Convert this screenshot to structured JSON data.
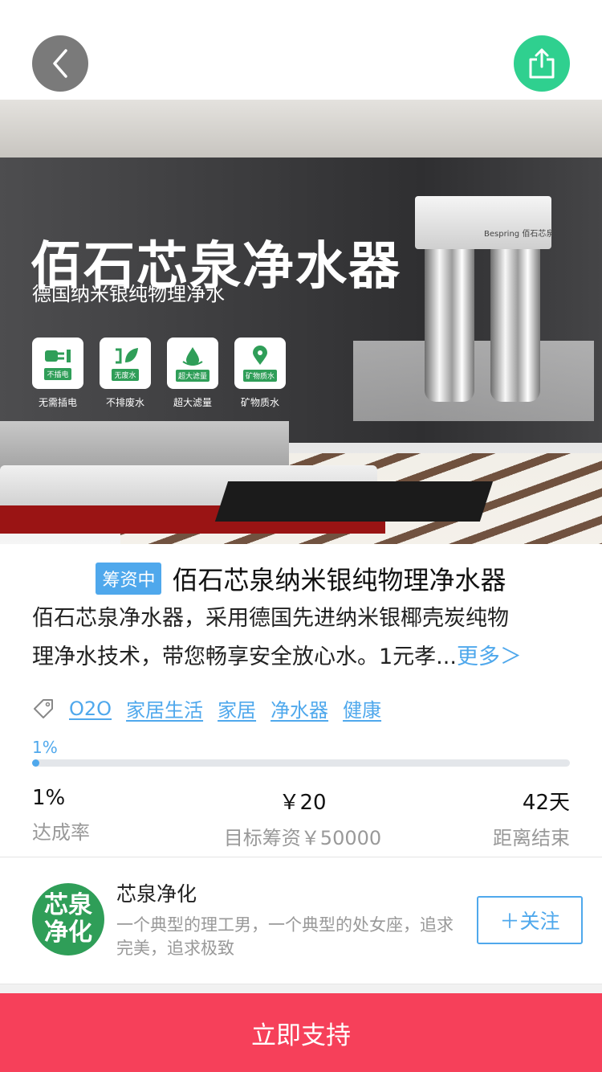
{
  "header": {
    "back_icon": "chevron-left-icon",
    "share_icon": "share-upload-icon",
    "share_color": "#2fd08f"
  },
  "hero": {
    "title": "佰石芯泉净水器",
    "subtitle": "德国纳米银纯物理净水",
    "features": [
      {
        "tag": "不插电",
        "caption": "无需插电",
        "icon": "plug-icon"
      },
      {
        "tag": "无废水",
        "caption": "不排废水",
        "icon": "leaf-icon"
      },
      {
        "tag": "超大滤量",
        "caption": "超大滤量",
        "icon": "water-drop-icon"
      },
      {
        "tag": "矿物质水",
        "caption": "矿物质水",
        "icon": "location-drop-icon"
      }
    ],
    "product_brand": "Bespring 佰石芯泉"
  },
  "project": {
    "status_badge": "筹资中",
    "title": "佰石芯泉纳米银纯物理净水器",
    "description_line1": "佰石芯泉净水器，采用德国先进纳米银椰壳炭纯物",
    "description_line2": "理净水技术，带您畅享安全放心水。1元孝...",
    "more_link": "更多＞",
    "tags": [
      "O2O",
      "家居生活",
      "家居",
      "净水器",
      "健康"
    ],
    "progress_label": "1%",
    "progress_fraction": 0.01
  },
  "stats": [
    {
      "value": "1%",
      "label": "达成率"
    },
    {
      "value": "￥20",
      "label": "目标筹资￥50000"
    },
    {
      "value": "42天",
      "label": "距离结束"
    }
  ],
  "creator": {
    "avatar_text_1": "芯泉",
    "avatar_text_2": "净化",
    "name": "芯泉净化",
    "bio": "一个典型的理工男，一个典型的处女座，追求完美，追求极致",
    "follow_label": "＋关注"
  },
  "footer": {
    "support_label": "立即支持",
    "support_color": "#f6405a"
  }
}
